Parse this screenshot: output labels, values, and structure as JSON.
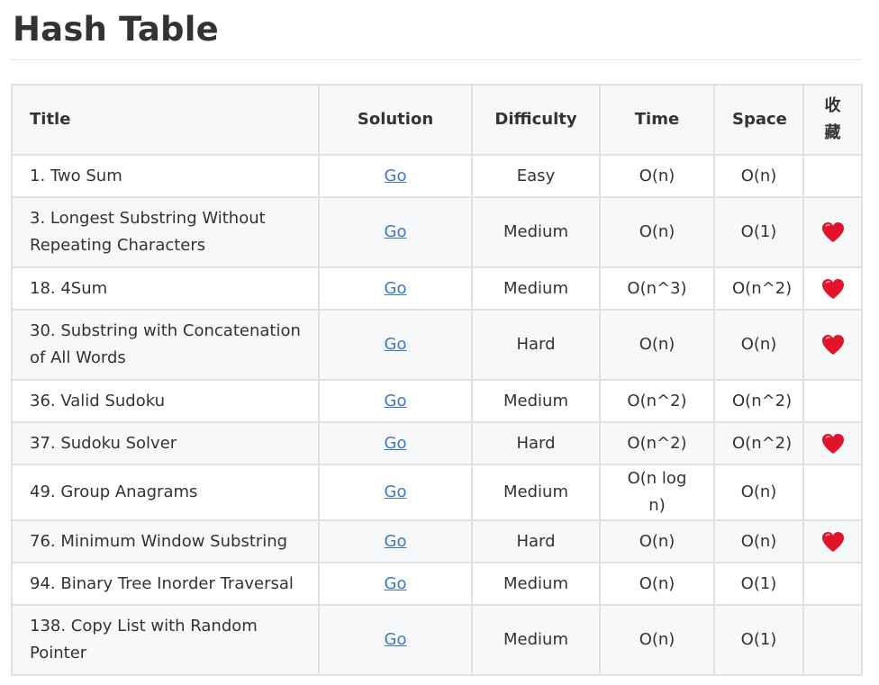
{
  "page": {
    "title": "Hash Table"
  },
  "table": {
    "headers": {
      "title": "Title",
      "solution": "Solution",
      "difficulty": "Difficulty",
      "time": "Time",
      "space": "Space",
      "favorite": "收藏"
    },
    "rows": [
      {
        "title": "1. Two Sum",
        "solution": "Go",
        "difficulty": "Easy",
        "time": "O(n)",
        "space": "O(n)",
        "favorite": false
      },
      {
        "title": "3. Longest Substring Without Repeating Characters",
        "solution": "Go",
        "difficulty": "Medium",
        "time": "O(n)",
        "space": "O(1)",
        "favorite": true
      },
      {
        "title": "18. 4Sum",
        "solution": "Go",
        "difficulty": "Medium",
        "time": "O(n^3)",
        "space": "O(n^2)",
        "favorite": true
      },
      {
        "title": "30. Substring with Concatenation of All Words",
        "solution": "Go",
        "difficulty": "Hard",
        "time": "O(n)",
        "space": "O(n)",
        "favorite": true
      },
      {
        "title": "36. Valid Sudoku",
        "solution": "Go",
        "difficulty": "Medium",
        "time": "O(n^2)",
        "space": "O(n^2)",
        "favorite": false
      },
      {
        "title": "37. Sudoku Solver",
        "solution": "Go",
        "difficulty": "Hard",
        "time": "O(n^2)",
        "space": "O(n^2)",
        "favorite": true
      },
      {
        "title": "49. Group Anagrams",
        "solution": "Go",
        "difficulty": "Medium",
        "time": "O(n log n)",
        "space": "O(n)",
        "favorite": false
      },
      {
        "title": "76. Minimum Window Substring",
        "solution": "Go",
        "difficulty": "Hard",
        "time": "O(n)",
        "space": "O(n)",
        "favorite": true
      },
      {
        "title": "94. Binary Tree Inorder Traversal",
        "solution": "Go",
        "difficulty": "Medium",
        "time": "O(n)",
        "space": "O(1)",
        "favorite": false
      },
      {
        "title": "138. Copy List with Random Pointer",
        "solution": "Go",
        "difficulty": "Medium",
        "time": "O(n)",
        "space": "O(1)",
        "favorite": false
      }
    ]
  },
  "colors": {
    "heart": "#e0142b",
    "link": "#4078c0",
    "header_bg": "#f6f8fa",
    "border": "#dfe2e5"
  },
  "icons": {
    "favorite": "heart-icon"
  }
}
